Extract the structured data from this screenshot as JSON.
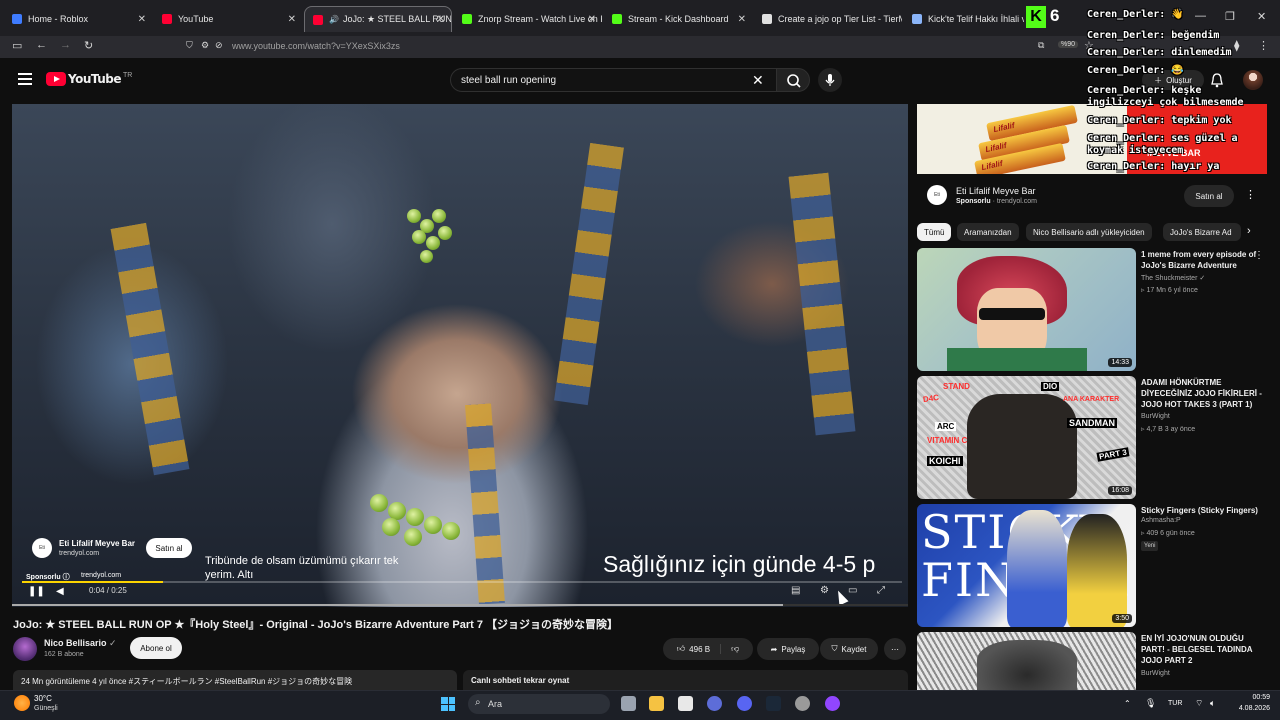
{
  "browser": {
    "tabs": [
      {
        "label": "Home - Roblox",
        "color": "#3f7cff"
      },
      {
        "label": "YouTube",
        "color": "#ff0033"
      },
      {
        "label": "JoJo: ★ STEEL BALL RUN O",
        "color": "#ff0033"
      },
      {
        "label": "Znorp Stream - Watch Live on K",
        "color": "#53fc18"
      },
      {
        "label": "Stream - Kick Dashboard",
        "color": "#53fc18"
      },
      {
        "label": "Create a jojo op Tier List - TierM",
        "color": "#e0e0e0"
      },
      {
        "label": "Kick'te Telif Hakkı İhlali ve R",
        "color": "#8ab4f8"
      }
    ],
    "url": "www.youtube.com/watch?v=YXexSXix3zs",
    "zoom_badge": "%90"
  },
  "youtube": {
    "logo_text": "YouTube",
    "logo_region": "TR",
    "search_value": "steel ball run opening",
    "create_label": "Oluştur"
  },
  "player": {
    "ad": {
      "title": "Eti Lifalif Meyve Bar",
      "domain": "trendyol.com",
      "buy_label": "Satın al",
      "logo_text": "Eti",
      "sponsor_label": "Sponsorlu",
      "sponsor_domain": "trendyol.com"
    },
    "subtitle_left": "Tribünde de olsam üzümümü çıkarır tek yerim. Altı",
    "subtitle_right": "Sağlığınız için günde 4-5 p",
    "time": "0:04 / 0:25",
    "progress": 0.16,
    "video_progress": 0.86
  },
  "video": {
    "title": "JoJo: ★ STEEL BALL RUN OP ★『Holy Steel』- Original - JoJo's Bizarre Adventure Part 7 【ジョジョの奇妙な冒険】",
    "channel": "Nico Bellisario",
    "subscribers": "162 B abone",
    "subscribe_label": "Abone ol",
    "likes": "496 B",
    "share_label": "Paylaş",
    "save_label": "Kaydet",
    "description_line": "24 Mn görüntüleme  4 yıl önce  #スティールボールラン #SteelBallRun #ジョジョの奇妙な冒険",
    "chat_replay_label": "Canlı sohbeti tekrar oynat"
  },
  "sidebar": {
    "ad": {
      "title": "Eti Lifalif Meyve Bar",
      "sponsor": "Sponsorlu",
      "domain": "trendyol.com",
      "buy_label": "Satın al",
      "banner_text": "Lifalif",
      "banner_sub": "MEYVE BAR"
    },
    "chips": [
      "Tümü",
      "Aramanızdan",
      "Nico Bellisario adlı yükleyiciden",
      "JoJo's Bizarre Ad"
    ],
    "videos": [
      {
        "title": "1 meme from every episode of JoJo's Bizarre Adventure",
        "channel": "The Shuckmeister",
        "meta": "17 Mn  6 yıl önce",
        "duration": "14:33",
        "badge": ""
      },
      {
        "title": "ADAMI HÖNKÜRTME DİYECEĞİNİZ JOJO FİKİRLERİ - JOJO HOT TAKES 3 (PART 1)",
        "channel": "BurWight",
        "meta": "4,7 B  3 ay önce",
        "duration": "16:08",
        "badge": ""
      },
      {
        "title": "Sticky Fingers (Sticky Fingers)",
        "channel": "Ashmasha:P",
        "meta": "409  6 gün önce",
        "duration": "3:50",
        "badge": "Yeni"
      },
      {
        "title": "EN İYİ JOJO'NUN OLDUĞU PART! - BELGESEL TADINDA JOJO PART 2",
        "channel": "BurWight",
        "meta": "",
        "duration": "",
        "badge": ""
      }
    ],
    "thumb_texts": {
      "v2": [
        "D4C",
        "STAND",
        "DIO",
        "ANA KARAKTER",
        "ARC",
        "SANDMAN",
        "VITAMIN C",
        "KOICHI",
        "PART 3"
      ],
      "v3": "STICKY FINGERS"
    }
  },
  "stream_overlay": {
    "kick_letter": "K",
    "viewer_count": "6",
    "chat": [
      "Ceren_Derler: 👋",
      "Ceren_Derler: beğendim",
      "Ceren_Derler: dinlemedim",
      "Ceren_Derler: 😂",
      "Ceren_Derler: keşke",
      "ingilizceyi çok bilmesemde",
      "Ceren_Derler: tepkim yok",
      "Ceren_Derler: ses güzel a",
      "koymak isteyecem",
      "Ceren_Derler: hayır ya"
    ]
  },
  "taskbar": {
    "temperature": "30°C",
    "weather": "Güneşli",
    "search_label": "Ara",
    "language": "TUR",
    "time": "00:59",
    "date": "4.08.2026"
  }
}
